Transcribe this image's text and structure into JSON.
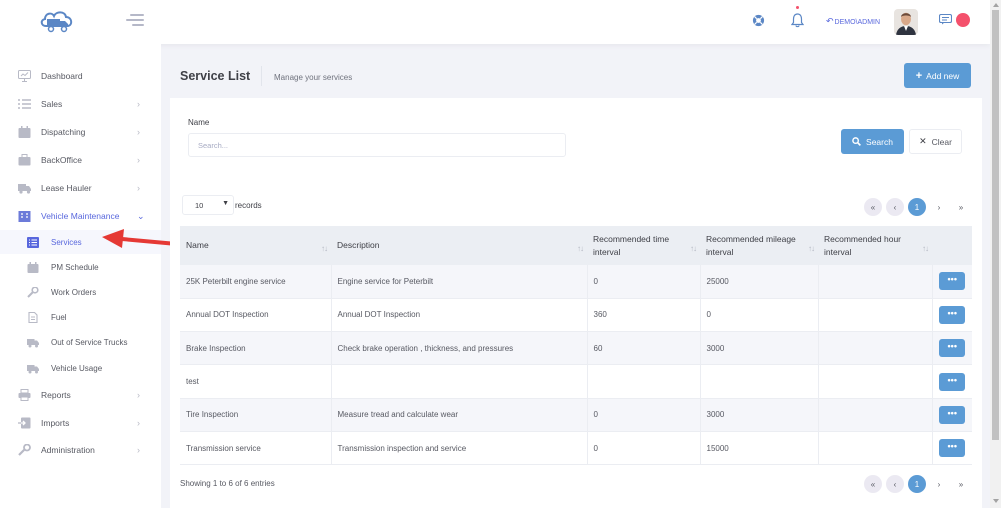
{
  "header": {
    "user_link": "DEMO\\ADMIN",
    "icons": [
      "truck-cloud-logo",
      "menu-icon",
      "support-icon",
      "bell-icon",
      "undo-arrow-icon",
      "chat-icon",
      "status-dot"
    ]
  },
  "sidebar": {
    "items": [
      {
        "label": "Dashboard",
        "icon": "monitor-icon"
      },
      {
        "label": "Sales",
        "icon": "list-icon",
        "chevron": "›"
      },
      {
        "label": "Dispatching",
        "icon": "calendar-icon",
        "chevron": "›"
      },
      {
        "label": "BackOffice",
        "icon": "briefcase-icon",
        "chevron": "›"
      },
      {
        "label": "Lease Hauler",
        "icon": "truck-icon",
        "chevron": "›"
      },
      {
        "label": "Vehicle Maintenance",
        "icon": "building-icon",
        "chevron": "⌄"
      },
      {
        "label": "Reports",
        "icon": "printer-icon",
        "chevron": "›"
      },
      {
        "label": "Imports",
        "icon": "import-icon",
        "chevron": "›"
      },
      {
        "label": "Administration",
        "icon": "wrench-icon",
        "chevron": "›"
      }
    ],
    "subitems": [
      {
        "label": "Services",
        "icon": "list-alt-icon"
      },
      {
        "label": "PM Schedule",
        "icon": "calendar-icon"
      },
      {
        "label": "Work Orders",
        "icon": "wrench-icon"
      },
      {
        "label": "Fuel",
        "icon": "file-icon"
      },
      {
        "label": "Out of Service Trucks",
        "icon": "truck-icon"
      },
      {
        "label": "Vehicle Usage",
        "icon": "truck-icon"
      }
    ]
  },
  "subheader": {
    "title": "Service List",
    "description": "Manage your services",
    "add_button": "Add new"
  },
  "filter": {
    "name_label": "Name",
    "search_placeholder": "Search...",
    "search_button": "Search",
    "clear_button": "Clear"
  },
  "table": {
    "page_size": "10",
    "records_label": "records",
    "columns": [
      "Name",
      "Description",
      "Recommended time interval",
      "Recommended mileage interval",
      "Recommended hour interval"
    ],
    "rows": [
      {
        "name": "25K Peterbilt engine service",
        "description": "Engine service for Peterbilt",
        "time": "0",
        "mileage": "25000",
        "hour": ""
      },
      {
        "name": "Annual DOT Inspection",
        "description": "Annual DOT Inspection",
        "time": "360",
        "mileage": "0",
        "hour": ""
      },
      {
        "name": "Brake Inspection",
        "description": "Check brake operation , thickness, and pressures",
        "time": "60",
        "mileage": "3000",
        "hour": ""
      },
      {
        "name": "test",
        "description": "",
        "time": "",
        "mileage": "",
        "hour": ""
      },
      {
        "name": "Tire Inspection",
        "description": "Measure tread and calculate wear",
        "time": "0",
        "mileage": "3000",
        "hour": ""
      },
      {
        "name": "Transmission service",
        "description": "Transmission inspection and service",
        "time": "0",
        "mileage": "15000",
        "hour": ""
      }
    ],
    "action_label": "•••",
    "showing": "Showing 1 to 6 of 6 entries",
    "pager": {
      "first": "«",
      "prev": "‹",
      "current": "1",
      "next": "›",
      "last": "»"
    }
  }
}
